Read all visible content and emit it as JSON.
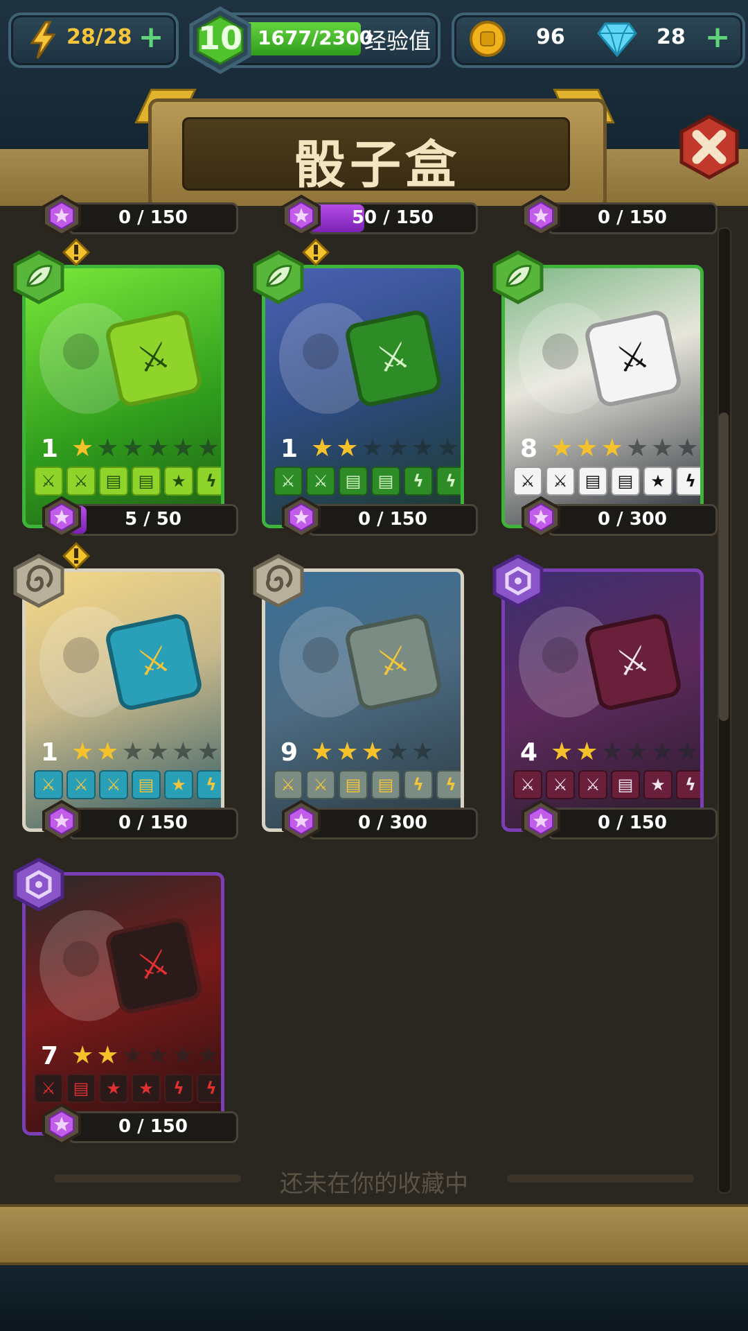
{
  "hud": {
    "energy": "28/28",
    "level": "10",
    "xp_text": "1677/2300",
    "xp_label": "经验值",
    "xp_progress": 0.729,
    "coins": "96",
    "gems": "28"
  },
  "title": "骰子盒",
  "footer_text": "还未在你的收藏中",
  "top_partial": [
    {
      "progress": "0 / 150",
      "fill": 0
    },
    {
      "progress": "50 / 150",
      "fill": 0.33
    },
    {
      "progress": "0 / 150",
      "fill": 0
    }
  ],
  "cards": [
    {
      "level": "1",
      "stars": 1,
      "max_stars": 6,
      "progress": "5 / 50",
      "fill": 0.1,
      "element": "nature",
      "alert": true,
      "faces": [
        "⚔",
        "⚔",
        "▤",
        "▤",
        "★",
        "ϟ"
      ],
      "theme": "green",
      "art": "slime"
    },
    {
      "level": "1",
      "stars": 2,
      "max_stars": 6,
      "progress": "0 / 150",
      "fill": 0,
      "element": "nature",
      "alert": true,
      "faces": [
        "⚔",
        "⚔",
        "▤",
        "▤",
        "ϟ",
        "ϟ"
      ],
      "theme": "darkgreen",
      "art": "hydra"
    },
    {
      "level": "8",
      "stars": 3,
      "max_stars": 6,
      "progress": "0 / 300",
      "fill": 0,
      "element": "nature",
      "alert": false,
      "faces": [
        "⚔",
        "⚔",
        "▤",
        "▤",
        "★",
        "ϟ"
      ],
      "theme": "white",
      "art": "panda"
    },
    {
      "level": "1",
      "stars": 2,
      "max_stars": 6,
      "progress": "0 / 150",
      "fill": 0,
      "element": "air",
      "alert": true,
      "faces": [
        "⚔",
        "⚔",
        "⚔",
        "▤",
        "★",
        "ϟ"
      ],
      "theme": "teal",
      "art": "griffin"
    },
    {
      "level": "9",
      "stars": 3,
      "max_stars": 5,
      "progress": "0 / 300",
      "fill": 0,
      "element": "air",
      "alert": false,
      "faces": [
        "⚔",
        "⚔",
        "▤",
        "▤",
        "ϟ",
        "ϟ"
      ],
      "theme": "slate",
      "art": "wizard"
    },
    {
      "level": "4",
      "stars": 2,
      "max_stars": 6,
      "progress": "0 / 150",
      "fill": 0,
      "element": "void",
      "alert": false,
      "faces": [
        "⚔",
        "⚔",
        "⚔",
        "▤",
        "★",
        "ϟ"
      ],
      "theme": "maroon",
      "art": "eye"
    },
    {
      "level": "7",
      "stars": 2,
      "max_stars": 6,
      "progress": "0 / 150",
      "fill": 0,
      "element": "void",
      "alert": false,
      "faces": [
        "⚔",
        "▤",
        "★",
        "★",
        "ϟ",
        "ϟ"
      ],
      "theme": "red",
      "art": "vampire"
    }
  ],
  "colors": {
    "nature_border": "#3fb43a",
    "air_border": "#d8d2c2",
    "void_border": "#7b3fb5"
  }
}
